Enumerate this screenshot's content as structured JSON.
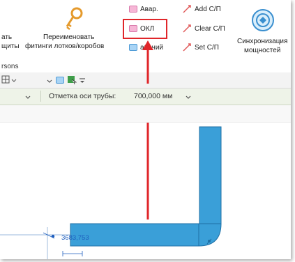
{
  "ribbon": {
    "left_partial_top": "ать",
    "left_partial_bottom": "щиты",
    "rename_button_line1": "Переименовать",
    "rename_button_line2": "фитинги лотков/коробов",
    "circuit_items": [
      {
        "label": "Авар.",
        "icon": "pink-circuit-icon"
      },
      {
        "label": "ОКЛ",
        "icon": "pink-circuit-icon"
      },
      {
        "label": "абочий",
        "icon": "blue-circuit-icon"
      }
    ],
    "sp_items": [
      {
        "label": "Add С/П",
        "icon": "add-link-icon"
      },
      {
        "label": "Clear С/П",
        "icon": "clear-link-icon"
      },
      {
        "label": "Set С/П",
        "icon": "set-link-icon"
      }
    ],
    "sync_button_line1": "Синхронизация",
    "sync_button_line2": "мощностей",
    "panel_label": "rsons"
  },
  "options": {
    "elevation_label": "Отметка оси трубы:",
    "elevation_value": "700,000 мм"
  },
  "drawing": {
    "dimension_text": "3683,753"
  },
  "colors": {
    "highlight": "#e0262a",
    "tray_fill": "#3a9fd8",
    "tray_stroke": "#1e6fa5"
  }
}
